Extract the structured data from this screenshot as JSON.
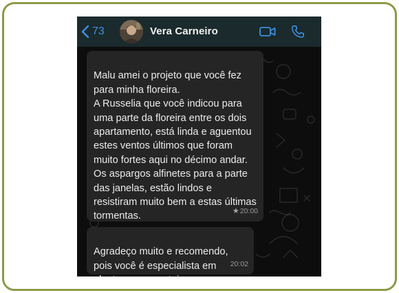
{
  "colors": {
    "frame_border": "#8b9a48",
    "header_bg": "#1b2a2c",
    "accent": "#3d90e3",
    "bubble_bg": "#252525",
    "chat_bg": "#0d0d0d"
  },
  "header": {
    "back_icon": "chevron-left-icon",
    "back_count": "73",
    "contact_name": "Vera Carneiro",
    "video_icon": "video-camera-icon",
    "call_icon": "phone-icon"
  },
  "messages": [
    {
      "text": "Malu amei o projeto que você fez para minha floreira.\nA Russelia que você indicou para uma parte da floreira entre os dois apartamento,  está linda e aguentou estes ventos últimos que foram muito fortes aqui no décimo andar.\nOs aspargos alfinetes para a parte das janelas,  estão lindos e resistiram muito bem a estas últimas tormentas.",
      "time": "20:00",
      "starred": true,
      "star_icon": "star-icon"
    },
    {
      "text": "Agradeço muito e recomendo, pois você é  especialista em plantas ornamentais.",
      "time": "20:02",
      "starred": false
    }
  ]
}
